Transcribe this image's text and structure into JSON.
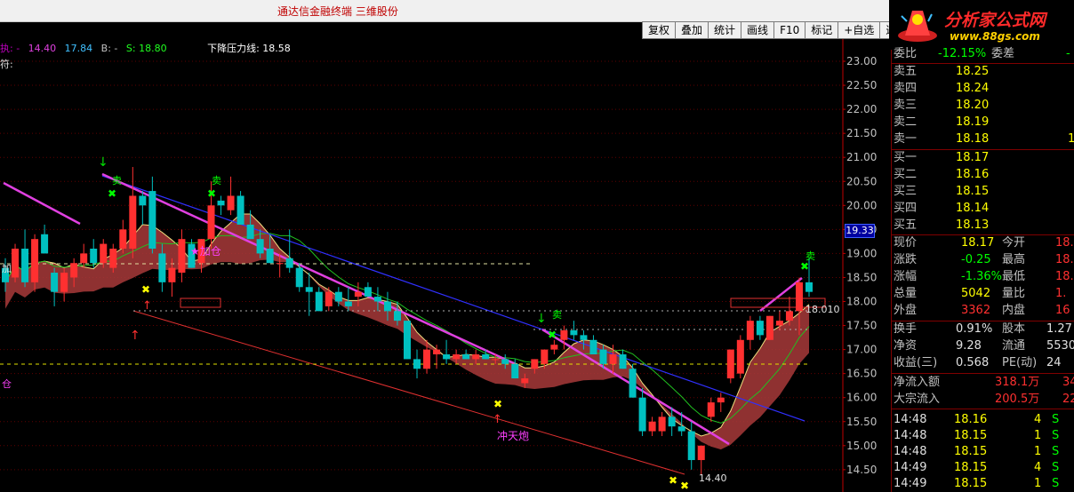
{
  "window": {
    "title": "通达信金融终端  三维股份"
  },
  "toolbar": {
    "buttons": [
      "复权",
      "叠加",
      "统计",
      "画线",
      "F10",
      "标记",
      "+自选",
      "返回"
    ]
  },
  "logo": {
    "brand": "分析家公式网",
    "url": "www.88gs.com"
  },
  "legend": {
    "a": "执: -",
    "b": "14.40",
    "c": "17.84",
    "d": "B: -",
    "e": "S: 18.80",
    "f": "下降压力线: 18.58",
    "g": "符:"
  },
  "chart_labels": {
    "add_pos": "★加仓",
    "chongtianpao": "冲天炮",
    "sell": "卖",
    "low_price": "14.40",
    "right_price": "18.010",
    "left_edge_1": "加",
    "left_edge_2": "仓",
    "current_price_tag": "19.33"
  },
  "y_axis": [
    "23.00",
    "22.50",
    "22.00",
    "21.50",
    "21.00",
    "20.50",
    "20.00",
    "19.50",
    "19.00",
    "18.50",
    "18.00",
    "17.50",
    "17.00",
    "16.50",
    "16.00",
    "15.50",
    "15.00",
    "14.50"
  ],
  "quote": {
    "header_partial": {
      "l1": "委比",
      "v1": "-12.15%",
      "l2": "委差",
      "v2": "-"
    },
    "asks": [
      {
        "label": "卖五",
        "price": "18.25",
        "vol": ""
      },
      {
        "label": "卖四",
        "price": "18.24",
        "vol": ""
      },
      {
        "label": "卖三",
        "price": "18.20",
        "vol": ""
      },
      {
        "label": "卖二",
        "price": "18.19",
        "vol": ""
      },
      {
        "label": "卖一",
        "price": "18.18",
        "vol": "1"
      }
    ],
    "bids": [
      {
        "label": "买一",
        "price": "18.17",
        "vol": ""
      },
      {
        "label": "买二",
        "price": "18.16",
        "vol": ""
      },
      {
        "label": "买三",
        "price": "18.15",
        "vol": ""
      },
      {
        "label": "买四",
        "price": "18.14",
        "vol": ""
      },
      {
        "label": "买五",
        "price": "18.13",
        "vol": ""
      }
    ],
    "stats": [
      {
        "l1": "现价",
        "v1": "18.17",
        "c1": "#ffff00",
        "l2": "今开",
        "v2": "18."
      },
      {
        "l1": "涨跌",
        "v1": "-0.25",
        "c1": "#00ff00",
        "l2": "最高",
        "v2": "18."
      },
      {
        "l1": "涨幅",
        "v1": "-1.36%",
        "c1": "#00ff00",
        "l2": "最低",
        "v2": "18."
      },
      {
        "l1": "总量",
        "v1": "5042",
        "c1": "#ffff00",
        "l2": "量比",
        "v2": "1."
      },
      {
        "l1": "外盘",
        "v1": "3362",
        "c1": "#ff3030",
        "l2": "内盘",
        "v2": "16"
      }
    ],
    "fund": [
      {
        "l1": "换手",
        "v1": "0.91%",
        "l2": "股本",
        "v2": "1.27"
      },
      {
        "l1": "净资",
        "v1": "9.28",
        "l2": "流通",
        "v2": "5530"
      },
      {
        "l1": "收益(三)",
        "v1": "0.568",
        "l2": "PE(动)",
        "v2": "24"
      }
    ],
    "flow": [
      {
        "label": "净流入额",
        "value": "318.1万",
        "extra": "34"
      },
      {
        "label": "大宗流入",
        "value": "200.5万",
        "extra": "22"
      }
    ],
    "ticks": [
      {
        "time": "14:48",
        "price": "18.16",
        "vol": "4",
        "side": "S"
      },
      {
        "time": "14:48",
        "price": "18.15",
        "vol": "1",
        "side": "S"
      },
      {
        "time": "14:48",
        "price": "18.15",
        "vol": "1",
        "side": "S"
      },
      {
        "time": "14:49",
        "price": "18.15",
        "vol": "4",
        "side": "S"
      },
      {
        "time": "14:49",
        "price": "18.15",
        "vol": "1",
        "side": "S"
      }
    ]
  },
  "colors": {
    "up": "#ff3030",
    "down": "#00c0c0",
    "pressure": "#e040e0",
    "channel": "#3030ff",
    "band": "#a83a3a"
  },
  "chart_data": {
    "type": "candlestick",
    "ylim": [
      14.3,
      23.2
    ],
    "candles": [
      [
        18.7,
        18.9,
        18.2,
        18.4
      ],
      [
        18.5,
        19.2,
        18.4,
        19.1
      ],
      [
        19.1,
        19.5,
        18.3,
        18.4
      ],
      [
        18.4,
        19.4,
        18.2,
        19.3
      ],
      [
        19.4,
        19.6,
        19.0,
        19.0
      ],
      [
        18.6,
        18.7,
        17.9,
        18.2
      ],
      [
        18.2,
        18.7,
        18.0,
        18.6
      ],
      [
        18.5,
        18.9,
        18.3,
        18.8
      ],
      [
        18.8,
        19.2,
        18.7,
        19.0
      ],
      [
        19.1,
        19.3,
        18.7,
        18.8
      ],
      [
        18.8,
        19.3,
        18.7,
        19.2
      ],
      [
        18.7,
        19.2,
        18.6,
        19.1
      ],
      [
        19.1,
        19.7,
        19.0,
        19.5
      ],
      [
        19.1,
        20.8,
        18.9,
        20.2
      ],
      [
        20.2,
        20.3,
        19.6,
        20.0
      ],
      [
        20.3,
        20.6,
        19.0,
        19.1
      ],
      [
        19.0,
        19.2,
        18.2,
        18.4
      ],
      [
        18.4,
        18.9,
        18.1,
        18.7
      ],
      [
        18.6,
        19.5,
        18.4,
        19.3
      ],
      [
        19.2,
        19.3,
        18.7,
        18.7
      ],
      [
        18.8,
        19.3,
        18.6,
        19.3
      ],
      [
        19.3,
        20.5,
        19.1,
        20.0
      ],
      [
        20.1,
        20.2,
        19.8,
        20.0
      ],
      [
        19.9,
        20.6,
        19.8,
        20.2
      ],
      [
        20.2,
        20.3,
        19.6,
        19.6
      ],
      [
        19.6,
        19.9,
        19.3,
        19.3
      ],
      [
        19.3,
        19.5,
        18.9,
        19.0
      ],
      [
        19.1,
        19.4,
        18.8,
        18.8
      ],
      [
        18.8,
        19.0,
        18.5,
        18.8
      ],
      [
        18.9,
        19.5,
        18.6,
        18.7
      ],
      [
        18.7,
        18.8,
        18.2,
        18.3
      ],
      [
        18.3,
        18.6,
        17.7,
        18.2
      ],
      [
        18.2,
        18.3,
        17.8,
        17.8
      ],
      [
        17.9,
        18.3,
        17.8,
        18.2
      ],
      [
        18.2,
        18.3,
        17.9,
        18.0
      ],
      [
        18.0,
        18.3,
        17.8,
        17.9
      ],
      [
        18.1,
        18.4,
        17.9,
        18.2
      ],
      [
        18.3,
        18.4,
        18.1,
        18.1
      ],
      [
        18.1,
        18.3,
        17.8,
        18.0
      ],
      [
        18.0,
        18.2,
        17.6,
        17.8
      ],
      [
        17.8,
        18.0,
        17.5,
        17.6
      ],
      [
        17.6,
        17.6,
        16.8,
        16.8
      ],
      [
        16.8,
        17.0,
        16.4,
        16.6
      ],
      [
        16.6,
        17.2,
        16.5,
        17.0
      ],
      [
        16.9,
        17.1,
        16.6,
        17.0
      ],
      [
        16.9,
        17.2,
        16.7,
        16.8
      ],
      [
        16.8,
        17.0,
        16.7,
        16.9
      ],
      [
        16.9,
        17.0,
        16.8,
        16.8
      ],
      [
        16.8,
        17.0,
        16.7,
        16.9
      ],
      [
        16.9,
        17.0,
        16.8,
        16.8
      ],
      [
        16.8,
        16.9,
        16.7,
        16.8
      ],
      [
        16.8,
        16.9,
        16.6,
        16.7
      ],
      [
        16.7,
        16.8,
        16.4,
        16.4
      ],
      [
        16.3,
        16.5,
        16.2,
        16.4
      ],
      [
        16.6,
        16.8,
        16.5,
        16.8
      ],
      [
        16.7,
        17.0,
        16.6,
        17.0
      ],
      [
        17.0,
        17.2,
        16.9,
        17.1
      ],
      [
        17.2,
        17.5,
        17.0,
        17.4
      ],
      [
        17.4,
        17.6,
        17.2,
        17.3
      ],
      [
        17.3,
        17.4,
        17.0,
        17.2
      ],
      [
        17.2,
        17.3,
        16.9,
        16.9
      ],
      [
        17.0,
        17.1,
        16.6,
        16.7
      ],
      [
        16.7,
        17.1,
        16.5,
        16.9
      ],
      [
        16.9,
        17.0,
        16.6,
        16.6
      ],
      [
        16.6,
        16.7,
        16.0,
        16.0
      ],
      [
        16.0,
        16.2,
        15.2,
        15.3
      ],
      [
        15.3,
        15.6,
        15.2,
        15.5
      ],
      [
        15.3,
        15.7,
        15.2,
        15.6
      ],
      [
        15.6,
        15.8,
        15.2,
        15.4
      ],
      [
        15.4,
        15.7,
        15.2,
        15.3
      ],
      [
        15.3,
        15.5,
        14.5,
        14.7
      ],
      [
        14.7,
        15.0,
        14.4,
        15.0
      ],
      [
        15.6,
        16.0,
        15.5,
        15.9
      ],
      [
        15.9,
        16.1,
        15.7,
        16.0
      ],
      [
        16.4,
        17.0,
        16.3,
        17.0
      ],
      [
        16.5,
        17.3,
        16.4,
        17.2
      ],
      [
        17.2,
        17.7,
        17.0,
        17.6
      ],
      [
        17.6,
        17.7,
        17.2,
        17.3
      ],
      [
        17.2,
        17.7,
        17.2,
        17.7
      ],
      [
        17.5,
        17.8,
        17.4,
        17.6
      ],
      [
        17.6,
        18.1,
        17.5,
        17.8
      ],
      [
        17.8,
        18.5,
        17.3,
        18.4
      ],
      [
        18.4,
        18.9,
        18.1,
        18.2
      ]
    ]
  }
}
